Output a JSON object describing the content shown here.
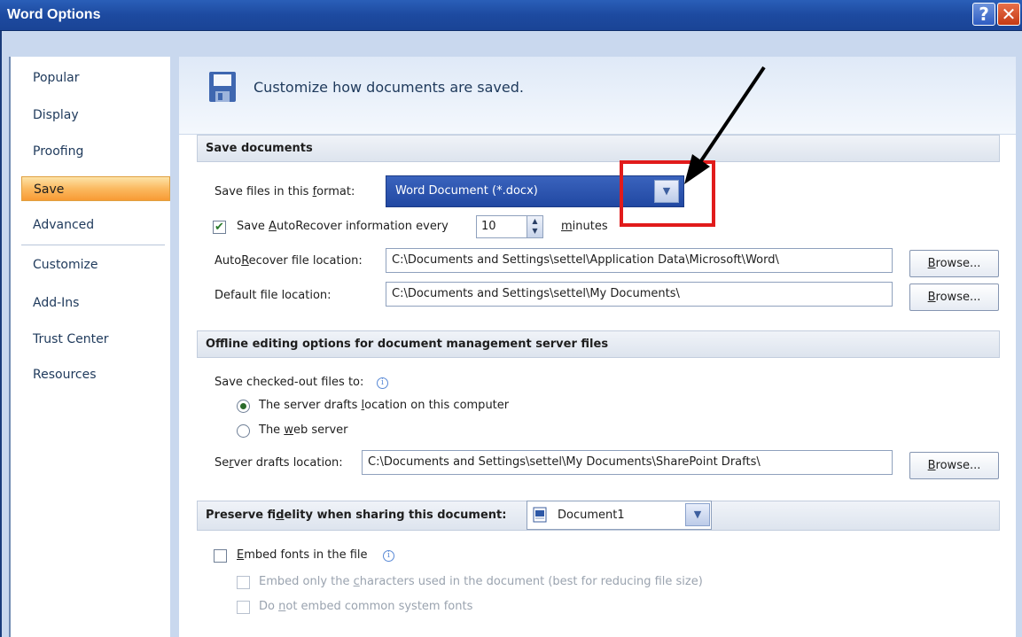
{
  "window": {
    "title": "Word Options",
    "help_glyph": "?",
    "close_glyph": "✕"
  },
  "nav": {
    "items": [
      {
        "label": "Popular"
      },
      {
        "label": "Display"
      },
      {
        "label": "Proofing"
      },
      {
        "label": "Save"
      },
      {
        "label": "Advanced"
      },
      {
        "label": "Customize"
      },
      {
        "label": "Add-Ins"
      },
      {
        "label": "Trust Center"
      },
      {
        "label": "Resources"
      }
    ],
    "active": "Save"
  },
  "header": {
    "title": "Customize how documents are saved.",
    "icon": "floppy-disk-icon"
  },
  "save_documents": {
    "section_title": "Save documents",
    "format_label_pre": "Save files in this ",
    "format_label_u": "f",
    "format_label_post": "ormat:",
    "format_value": "Word Document (*.docx)",
    "autorecover_checked": true,
    "autorecover_pre": "Save ",
    "autorecover_u": "A",
    "autorecover_post": "utoRecover information every",
    "autorecover_minutes": "10",
    "minutes_u": "m",
    "minutes_rest": "inutes",
    "ar_location_pre": "Auto",
    "ar_location_u": "R",
    "ar_location_post": "ecover file location:",
    "ar_location_value": "C:\\Documents and Settings\\settel\\Application Data\\Microsoft\\Word\\",
    "default_location_pre": "Default f",
    "default_location_u": "i",
    "default_location_post": "le location:",
    "default_location_value": "C:\\Documents and Settings\\settel\\My Documents\\",
    "browse_u": "B",
    "browse_rest": "rowse..."
  },
  "offline": {
    "section_title": "Offline editing options for document management server files",
    "checked_out_label": "Save checked-out files to:",
    "opt1_pre": "The server drafts ",
    "opt1_u": "l",
    "opt1_post": "ocation on this computer",
    "opt1_selected": true,
    "opt2_pre": "The ",
    "opt2_u": "w",
    "opt2_post": "eb server",
    "opt2_selected": false,
    "drafts_pre": "Se",
    "drafts_u": "r",
    "drafts_post": "ver drafts location:",
    "drafts_value": "C:\\Documents and Settings\\settel\\My Documents\\SharePoint Drafts\\"
  },
  "fidelity": {
    "section_pre": "Preserve fi",
    "section_u": "d",
    "section_post": "elity when sharing this document:",
    "document": "Document1",
    "embed_checked": false,
    "embed_u": "E",
    "embed_rest": "mbed fonts in the file",
    "embed_only_pre": "Embed only the ",
    "embed_only_u": "c",
    "embed_only_post": "haracters used in the document (best for reducing file size)",
    "no_common_pre": "Do ",
    "no_common_u": "n",
    "no_common_post": "ot embed common system fonts"
  },
  "annotation": {
    "highlight_color": "#e11b1b",
    "arrow_color": "#000000"
  }
}
